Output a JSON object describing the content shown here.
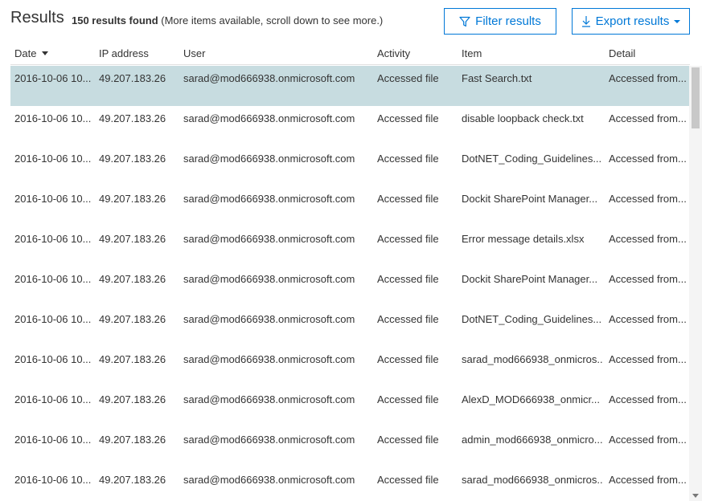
{
  "header": {
    "title": "Results",
    "count": "150 results found",
    "note": "(More items available, scroll down to see more.)",
    "filter_label": "Filter results",
    "export_label": "Export results"
  },
  "columns": {
    "date": "Date",
    "ip": "IP address",
    "user": "User",
    "activity": "Activity",
    "item": "Item",
    "detail": "Detail"
  },
  "rows": [
    {
      "date": "2016-10-06 10...",
      "ip": "49.207.183.26",
      "user": "sarad@mod666938.onmicrosoft.com",
      "activity": "Accessed file",
      "item": "Fast Search.txt",
      "detail": "Accessed from..."
    },
    {
      "date": "2016-10-06 10...",
      "ip": "49.207.183.26",
      "user": "sarad@mod666938.onmicrosoft.com",
      "activity": "Accessed file",
      "item": "disable loopback check.txt",
      "detail": "Accessed from..."
    },
    {
      "date": "2016-10-06 10...",
      "ip": "49.207.183.26",
      "user": "sarad@mod666938.onmicrosoft.com",
      "activity": "Accessed file",
      "item": "DotNET_Coding_Guidelines....",
      "detail": "Accessed from..."
    },
    {
      "date": "2016-10-06 10...",
      "ip": "49.207.183.26",
      "user": "sarad@mod666938.onmicrosoft.com",
      "activity": "Accessed file",
      "item": "Dockit SharePoint Manager...",
      "detail": "Accessed from..."
    },
    {
      "date": "2016-10-06 10...",
      "ip": "49.207.183.26",
      "user": "sarad@mod666938.onmicrosoft.com",
      "activity": "Accessed file",
      "item": "Error message details.xlsx",
      "detail": "Accessed from..."
    },
    {
      "date": "2016-10-06 10...",
      "ip": "49.207.183.26",
      "user": "sarad@mod666938.onmicrosoft.com",
      "activity": "Accessed file",
      "item": "Dockit SharePoint Manager...",
      "detail": "Accessed from..."
    },
    {
      "date": "2016-10-06 10...",
      "ip": "49.207.183.26",
      "user": "sarad@mod666938.onmicrosoft.com",
      "activity": "Accessed file",
      "item": "DotNET_Coding_Guidelines....",
      "detail": "Accessed from..."
    },
    {
      "date": "2016-10-06 10...",
      "ip": "49.207.183.26",
      "user": "sarad@mod666938.onmicrosoft.com",
      "activity": "Accessed file",
      "item": "sarad_mod666938_onmicros...",
      "detail": "Accessed from..."
    },
    {
      "date": "2016-10-06 10...",
      "ip": "49.207.183.26",
      "user": "sarad@mod666938.onmicrosoft.com",
      "activity": "Accessed file",
      "item": "AlexD_MOD666938_onmicr...",
      "detail": "Accessed from..."
    },
    {
      "date": "2016-10-06 10...",
      "ip": "49.207.183.26",
      "user": "sarad@mod666938.onmicrosoft.com",
      "activity": "Accessed file",
      "item": "admin_mod666938_onmicro...",
      "detail": "Accessed from..."
    },
    {
      "date": "2016-10-06 10...",
      "ip": "49.207.183.26",
      "user": "sarad@mod666938.onmicrosoft.com",
      "activity": "Accessed file",
      "item": "sarad_mod666938_onmicros...",
      "detail": "Accessed from..."
    }
  ],
  "selected_row": 0,
  "icons": {
    "filter": "filter-icon",
    "export": "download-icon",
    "export_menu": "chevron-down-icon",
    "sort": "sort-descending-icon"
  },
  "colors": {
    "accent": "#0078d7",
    "selected_row": "#c7dce0"
  }
}
